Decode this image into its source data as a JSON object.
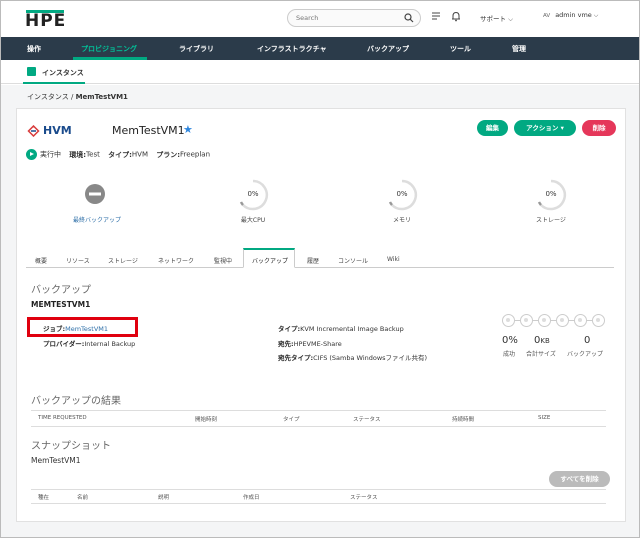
{
  "header": {
    "logo": "HPE",
    "search_placeholder": "Search",
    "support_label": "サポート",
    "avatar_initials": "AV",
    "user_name": "admin vme"
  },
  "main_nav": [
    {
      "label": "操作"
    },
    {
      "label": "プロビジョニング",
      "active": true
    },
    {
      "label": "ライブラリ"
    },
    {
      "label": "インフラストラクチャ"
    },
    {
      "label": "バックアップ"
    },
    {
      "label": "ツール"
    },
    {
      "label": "管理"
    }
  ],
  "sub_nav": {
    "label": "インスタンス"
  },
  "breadcrumb": {
    "parent": "インスタンス",
    "separator": "/",
    "current": "MemTestVM1"
  },
  "instance": {
    "cloud_type": "HVM",
    "name": "MemTestVM1",
    "buttons": {
      "edit": "編集",
      "actions": "アクション ▾",
      "delete": "削除"
    },
    "status": {
      "state": "実行中",
      "env_label": "環境:",
      "env_value": "Test",
      "type_label": "タイプ:",
      "type_value": "HVM",
      "plan_label": "プラン:",
      "plan_value": "Freeplan"
    }
  },
  "stats": {
    "last_backup_label": "最終バックアップ",
    "cpu_value": "0%",
    "cpu_label": "最大CPU",
    "memory_value": "0%",
    "memory_label": "メモリ",
    "storage_value": "0%",
    "storage_label": "ストレージ"
  },
  "tabs": [
    {
      "label": "概要"
    },
    {
      "label": "リソース"
    },
    {
      "label": "ストレージ"
    },
    {
      "label": "ネットワーク"
    },
    {
      "label": "監視中"
    },
    {
      "label": "バックアップ",
      "active": true
    },
    {
      "label": "履歴"
    },
    {
      "label": "コンソール"
    },
    {
      "label": "Wiki"
    }
  ],
  "backup": {
    "section_title": "バックアップ",
    "name": "MEMTESTVM1",
    "job_label": "ジョブ:",
    "job_value": "MemTestVM1",
    "provider_label": "プロバイダー:",
    "provider_value": "Internal Backup",
    "type_label": "タイプ:",
    "type_value": "KVM Incremental Image Backup",
    "dest_label": "宛先:",
    "dest_value": "HPEVME-Share",
    "dest_type_label": "宛先タイプ:",
    "dest_type_value": "CIFS (Samba Windowsファイル共有)",
    "summary": {
      "success_value": "0%",
      "success_label": "成功",
      "size_value": "0",
      "size_unit": "KB",
      "size_label": "合計サイズ",
      "count_value": "0",
      "count_label": "バックアップ"
    }
  },
  "results": {
    "title": "バックアップの結果",
    "columns": [
      "TIME REQUESTED",
      "開始時刻",
      "タイプ",
      "ステータス",
      "持続時間",
      "SIZE"
    ]
  },
  "snapshots": {
    "title": "スナップショット",
    "name": "MemTestVM1",
    "delete_all": "すべてを削除",
    "columns": [
      "種在",
      "名前",
      "説明",
      "作成日",
      "ステータス"
    ]
  }
}
